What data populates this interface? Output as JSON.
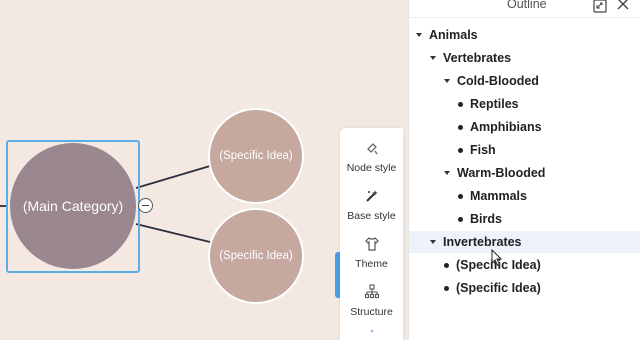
{
  "canvas": {
    "main_node": {
      "label": "(Main Category)",
      "color": "#9a8790"
    },
    "sub_nodes": [
      {
        "label": "(Specific Idea)",
        "color": "#c6a89f"
      },
      {
        "label": "(Specific Idea)",
        "color": "#c6a89f"
      }
    ],
    "selection_color": "#5aaee8"
  },
  "toolbar": {
    "items": [
      {
        "label": "Node style",
        "icon": "node-style-icon"
      },
      {
        "label": "Base style",
        "icon": "base-style-icon"
      },
      {
        "label": "Theme",
        "icon": "theme-icon"
      },
      {
        "label": "Structure",
        "icon": "structure-icon"
      }
    ],
    "active_color": "#4b9ee6"
  },
  "outline": {
    "title": "Outline",
    "items": [
      {
        "label": "Animals",
        "level": 0,
        "marker": "caret"
      },
      {
        "label": "Vertebrates",
        "level": 1,
        "marker": "caret"
      },
      {
        "label": "Cold-Blooded",
        "level": 2,
        "marker": "caret"
      },
      {
        "label": "Reptiles",
        "level": 3,
        "marker": "bullet"
      },
      {
        "label": "Amphibians",
        "level": 3,
        "marker": "bullet"
      },
      {
        "label": "Fish",
        "level": 3,
        "marker": "bullet"
      },
      {
        "label": "Warm-Blooded",
        "level": 2,
        "marker": "caret"
      },
      {
        "label": "Mammals",
        "level": 3,
        "marker": "bullet"
      },
      {
        "label": "Birds",
        "level": 3,
        "marker": "bullet"
      },
      {
        "label": "Invertebrates",
        "level": 1,
        "marker": "caret",
        "highlighted": true
      },
      {
        "label": "(Specific Idea)",
        "level": 2,
        "marker": "bullet"
      },
      {
        "label": "(Specific Idea)",
        "level": 2,
        "marker": "bullet"
      }
    ]
  }
}
